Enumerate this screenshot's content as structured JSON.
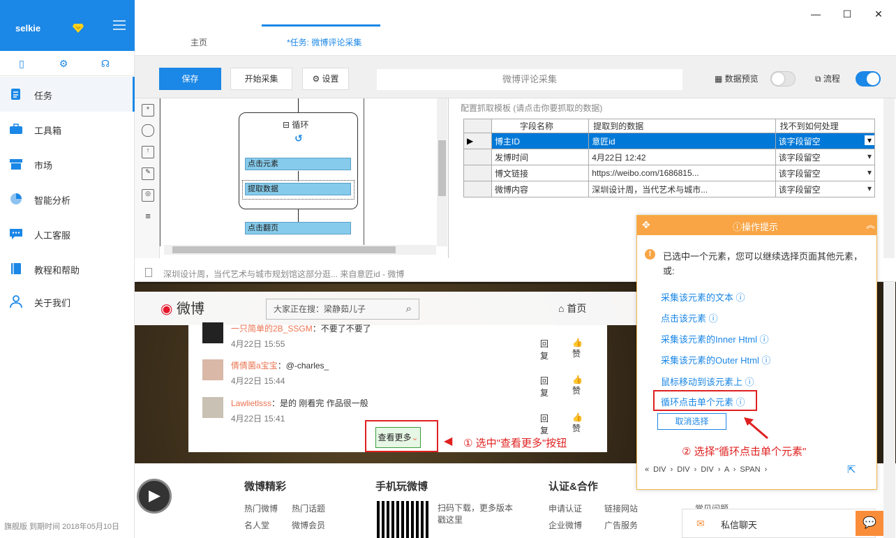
{
  "sidebar": {
    "username": "selkie",
    "icons": [
      "new-task-icon",
      "gear-icon",
      "headset-icon"
    ],
    "items": [
      {
        "label": "任务",
        "icon": "task-icon",
        "active": true
      },
      {
        "label": "工具箱",
        "icon": "toolbox-icon"
      },
      {
        "label": "市场",
        "icon": "market-icon"
      },
      {
        "label": "智能分析",
        "icon": "pie-chart-icon"
      },
      {
        "label": "人工客服",
        "icon": "chat-icon"
      },
      {
        "label": "教程和帮助",
        "icon": "book-icon"
      },
      {
        "label": "关于我们",
        "icon": "user-icon"
      }
    ],
    "footer": "旗舰版  到期时间  2018年05月10日"
  },
  "tabs": [
    {
      "label": "主页"
    },
    {
      "label": "*任务: 微博评论采集",
      "active": true
    }
  ],
  "toolbar": {
    "save": "保存",
    "start": "开始采集",
    "settings": "设置",
    "task_name": "微博评论采集",
    "preview_label": "数据预览",
    "preview_on": false,
    "flow_label": "流程",
    "flow_on": true
  },
  "flow": {
    "loop_label": "循环",
    "steps": [
      "点击元素",
      "提取数据",
      "点击翻页"
    ]
  },
  "template": {
    "hint": "配置抓取模板 (请点击你要抓取的数据)",
    "columns": [
      "字段名称",
      "提取到的数据",
      "找不到如何处理"
    ],
    "rows": [
      {
        "name": "博主ID",
        "value": "意匠id",
        "handling": "该字段留空",
        "selected": true
      },
      {
        "name": "发博时间",
        "value": "4月22日 12:42",
        "handling": "该字段留空"
      },
      {
        "name": "博文链接",
        "value": "https://weibo.com/1686815...",
        "handling": "该字段留空"
      },
      {
        "name": "微博内容",
        "value": "深圳设计周，当代艺术与城市...",
        "handling": "该字段留空"
      }
    ]
  },
  "browser": {
    "url": "深圳设计周，当代艺术与城市规划馆这部分逛... 来自意匠id - 微博",
    "weibo_logo": "微博",
    "search_placeholder": "大家正在搜：梁静茹儿子",
    "home_link": "首页",
    "comments": [
      {
        "name": "一只简单的2B_SSGM",
        "text": "：不要了不要了",
        "time": "4月22日 15:55"
      },
      {
        "name": "倩倩菌a宝宝",
        "text": "：@-charles_",
        "time": "4月22日 15:44"
      },
      {
        "name": "Lawlietlsss",
        "text": "：是的 刚看完 作品很一般",
        "time": "4月22日 15:41"
      }
    ],
    "reply": "回复",
    "like": "赞",
    "see_more": "查看更多",
    "note1": "① 选中\"查看更多\"按钮",
    "footer": {
      "col1_title": "微博精彩",
      "col1_links": [
        "热门微博",
        "热门话题",
        "名人堂",
        "微博会员"
      ],
      "col2_title": "手机玩微博",
      "col2_text": "扫码下载，更多版本戳这里",
      "col3_title": "认证&合作",
      "col3_links": [
        "申请认证",
        "链接网站",
        "企业微博",
        "广告服务"
      ],
      "col4_link": "常见问题"
    }
  },
  "popup": {
    "title": "操作提示",
    "message": "已选中一个元素，您可以继续选择页面其他元素，或:",
    "options": [
      "采集该元素的文本",
      "点击该元素",
      "采集该元素的Inner Html",
      "采集该元素的Outer Html",
      "鼠标移动到该元素上",
      "循环点击单个元素"
    ],
    "cancel": "取消选择",
    "note2": "② 选择\"循环点击单个元素\"",
    "crumbs": "«  DIV  ›  DIV  ›  DIV  ›  A  ›  SPAN  ›"
  },
  "chat": {
    "label": "私信聊天"
  }
}
